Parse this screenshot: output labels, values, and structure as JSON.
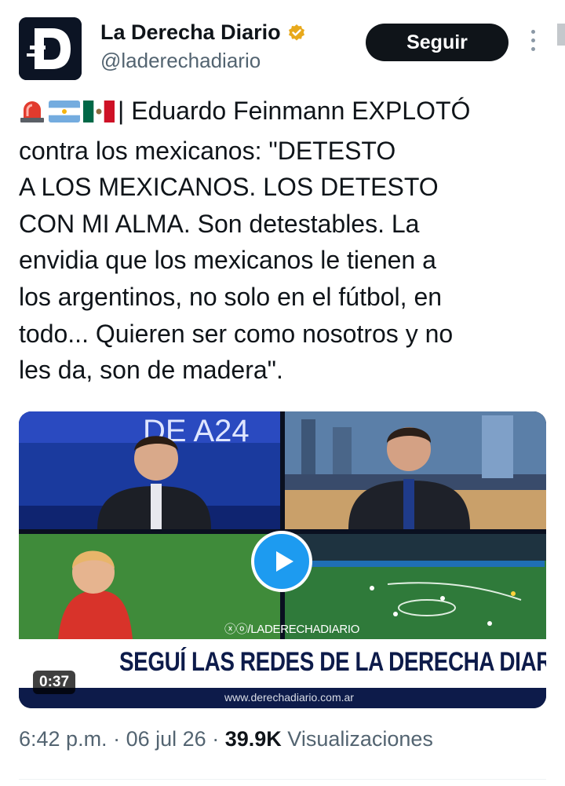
{
  "account": {
    "display_name": "La Derecha Diario",
    "handle": "@laderechadiario",
    "avatar_letter": "D",
    "verified": true
  },
  "actions": {
    "follow_label": "Seguir",
    "more_icon": "more-vertical-icon"
  },
  "tweet": {
    "emojis": [
      "rotating-light-icon",
      "argentina-flag-icon",
      "mexico-flag-icon"
    ],
    "lines": [
      "| Eduardo Feinmann EXPLOTÓ",
      "contra los mexicanos: \"DETESTO",
      "A LOS MEXICANOS. LOS DETESTO",
      "CON MI ALMA. Son detestables. La",
      "envidia que los mexicanos le tienen a",
      "los argentinos, no solo en el fútbol, en",
      "todo... Quieren ser como nosotros y no",
      "les da, son de madera\"."
    ]
  },
  "media": {
    "studio_sign": "DE A24",
    "watermark": "ⓧⓞ/LADERECHADIARIO",
    "banner_text": "SEGUÍ LAS REDES DE LA DERECHA DIARIO",
    "website": "www.derechadiario.com.ar",
    "duration": "0:37",
    "play_icon": "play-icon"
  },
  "meta": {
    "time": "6:42 p.m.",
    "separator": "·",
    "date": "06 jul 26",
    "views_count": "39.9K",
    "views_label": "Visualizaciones"
  },
  "colors": {
    "accent": "#1d9bf0",
    "text": "#0f1419",
    "secondary": "#536471",
    "badge": "#e8a91b"
  }
}
